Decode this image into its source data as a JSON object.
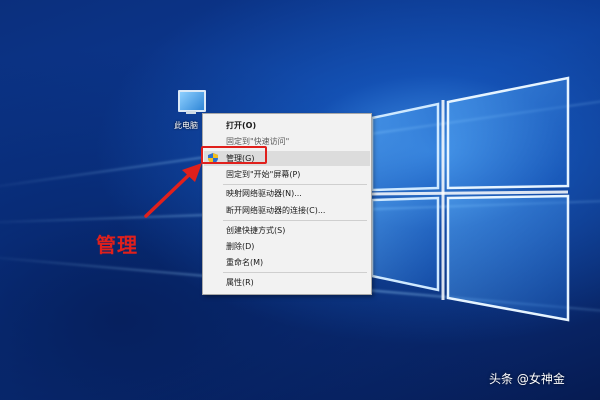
{
  "desktop": {
    "icon": {
      "name": "this-pc-icon",
      "label": "此电脑"
    }
  },
  "context_menu": {
    "items": [
      {
        "label": "打开(O)",
        "bold": true
      },
      {
        "label": "固定到\"快速访问\"",
        "muted": true
      },
      {
        "label": "管理(G)",
        "icon": "shield-icon",
        "highlighted": true
      },
      {
        "label": "固定到\"开始\"屏幕(P)"
      },
      {
        "label": "映射网络驱动器(N)..."
      },
      {
        "label": "断开网络驱动器的连接(C)..."
      },
      {
        "label": "创建快捷方式(S)"
      },
      {
        "label": "删除(D)"
      },
      {
        "label": "重命名(M)"
      },
      {
        "label": "属性(R)"
      }
    ]
  },
  "annotation": {
    "text": "管理",
    "color": "#e0201c"
  },
  "watermark": {
    "text": "头条 @女神金"
  }
}
